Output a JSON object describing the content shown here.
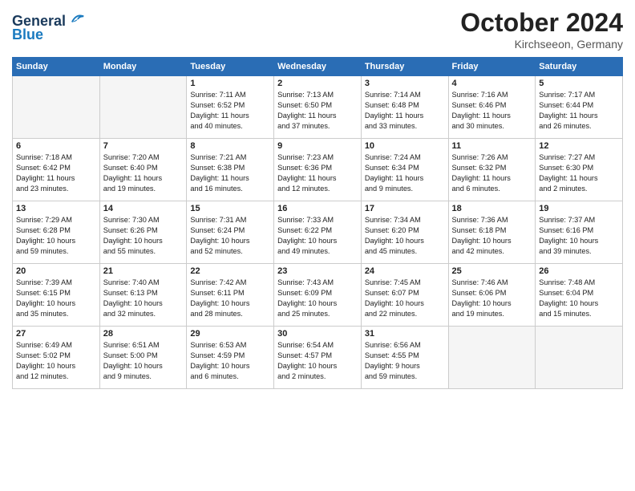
{
  "header": {
    "logo_line1": "General",
    "logo_line2": "Blue",
    "month": "October 2024",
    "location": "Kirchseeon, Germany"
  },
  "weekdays": [
    "Sunday",
    "Monday",
    "Tuesday",
    "Wednesday",
    "Thursday",
    "Friday",
    "Saturday"
  ],
  "weeks": [
    [
      {
        "day": "",
        "info": ""
      },
      {
        "day": "",
        "info": ""
      },
      {
        "day": "1",
        "info": "Sunrise: 7:11 AM\nSunset: 6:52 PM\nDaylight: 11 hours\nand 40 minutes."
      },
      {
        "day": "2",
        "info": "Sunrise: 7:13 AM\nSunset: 6:50 PM\nDaylight: 11 hours\nand 37 minutes."
      },
      {
        "day": "3",
        "info": "Sunrise: 7:14 AM\nSunset: 6:48 PM\nDaylight: 11 hours\nand 33 minutes."
      },
      {
        "day": "4",
        "info": "Sunrise: 7:16 AM\nSunset: 6:46 PM\nDaylight: 11 hours\nand 30 minutes."
      },
      {
        "day": "5",
        "info": "Sunrise: 7:17 AM\nSunset: 6:44 PM\nDaylight: 11 hours\nand 26 minutes."
      }
    ],
    [
      {
        "day": "6",
        "info": "Sunrise: 7:18 AM\nSunset: 6:42 PM\nDaylight: 11 hours\nand 23 minutes."
      },
      {
        "day": "7",
        "info": "Sunrise: 7:20 AM\nSunset: 6:40 PM\nDaylight: 11 hours\nand 19 minutes."
      },
      {
        "day": "8",
        "info": "Sunrise: 7:21 AM\nSunset: 6:38 PM\nDaylight: 11 hours\nand 16 minutes."
      },
      {
        "day": "9",
        "info": "Sunrise: 7:23 AM\nSunset: 6:36 PM\nDaylight: 11 hours\nand 12 minutes."
      },
      {
        "day": "10",
        "info": "Sunrise: 7:24 AM\nSunset: 6:34 PM\nDaylight: 11 hours\nand 9 minutes."
      },
      {
        "day": "11",
        "info": "Sunrise: 7:26 AM\nSunset: 6:32 PM\nDaylight: 11 hours\nand 6 minutes."
      },
      {
        "day": "12",
        "info": "Sunrise: 7:27 AM\nSunset: 6:30 PM\nDaylight: 11 hours\nand 2 minutes."
      }
    ],
    [
      {
        "day": "13",
        "info": "Sunrise: 7:29 AM\nSunset: 6:28 PM\nDaylight: 10 hours\nand 59 minutes."
      },
      {
        "day": "14",
        "info": "Sunrise: 7:30 AM\nSunset: 6:26 PM\nDaylight: 10 hours\nand 55 minutes."
      },
      {
        "day": "15",
        "info": "Sunrise: 7:31 AM\nSunset: 6:24 PM\nDaylight: 10 hours\nand 52 minutes."
      },
      {
        "day": "16",
        "info": "Sunrise: 7:33 AM\nSunset: 6:22 PM\nDaylight: 10 hours\nand 49 minutes."
      },
      {
        "day": "17",
        "info": "Sunrise: 7:34 AM\nSunset: 6:20 PM\nDaylight: 10 hours\nand 45 minutes."
      },
      {
        "day": "18",
        "info": "Sunrise: 7:36 AM\nSunset: 6:18 PM\nDaylight: 10 hours\nand 42 minutes."
      },
      {
        "day": "19",
        "info": "Sunrise: 7:37 AM\nSunset: 6:16 PM\nDaylight: 10 hours\nand 39 minutes."
      }
    ],
    [
      {
        "day": "20",
        "info": "Sunrise: 7:39 AM\nSunset: 6:15 PM\nDaylight: 10 hours\nand 35 minutes."
      },
      {
        "day": "21",
        "info": "Sunrise: 7:40 AM\nSunset: 6:13 PM\nDaylight: 10 hours\nand 32 minutes."
      },
      {
        "day": "22",
        "info": "Sunrise: 7:42 AM\nSunset: 6:11 PM\nDaylight: 10 hours\nand 28 minutes."
      },
      {
        "day": "23",
        "info": "Sunrise: 7:43 AM\nSunset: 6:09 PM\nDaylight: 10 hours\nand 25 minutes."
      },
      {
        "day": "24",
        "info": "Sunrise: 7:45 AM\nSunset: 6:07 PM\nDaylight: 10 hours\nand 22 minutes."
      },
      {
        "day": "25",
        "info": "Sunrise: 7:46 AM\nSunset: 6:06 PM\nDaylight: 10 hours\nand 19 minutes."
      },
      {
        "day": "26",
        "info": "Sunrise: 7:48 AM\nSunset: 6:04 PM\nDaylight: 10 hours\nand 15 minutes."
      }
    ],
    [
      {
        "day": "27",
        "info": "Sunrise: 6:49 AM\nSunset: 5:02 PM\nDaylight: 10 hours\nand 12 minutes."
      },
      {
        "day": "28",
        "info": "Sunrise: 6:51 AM\nSunset: 5:00 PM\nDaylight: 10 hours\nand 9 minutes."
      },
      {
        "day": "29",
        "info": "Sunrise: 6:53 AM\nSunset: 4:59 PM\nDaylight: 10 hours\nand 6 minutes."
      },
      {
        "day": "30",
        "info": "Sunrise: 6:54 AM\nSunset: 4:57 PM\nDaylight: 10 hours\nand 2 minutes."
      },
      {
        "day": "31",
        "info": "Sunrise: 6:56 AM\nSunset: 4:55 PM\nDaylight: 9 hours\nand 59 minutes."
      },
      {
        "day": "",
        "info": ""
      },
      {
        "day": "",
        "info": ""
      }
    ]
  ]
}
